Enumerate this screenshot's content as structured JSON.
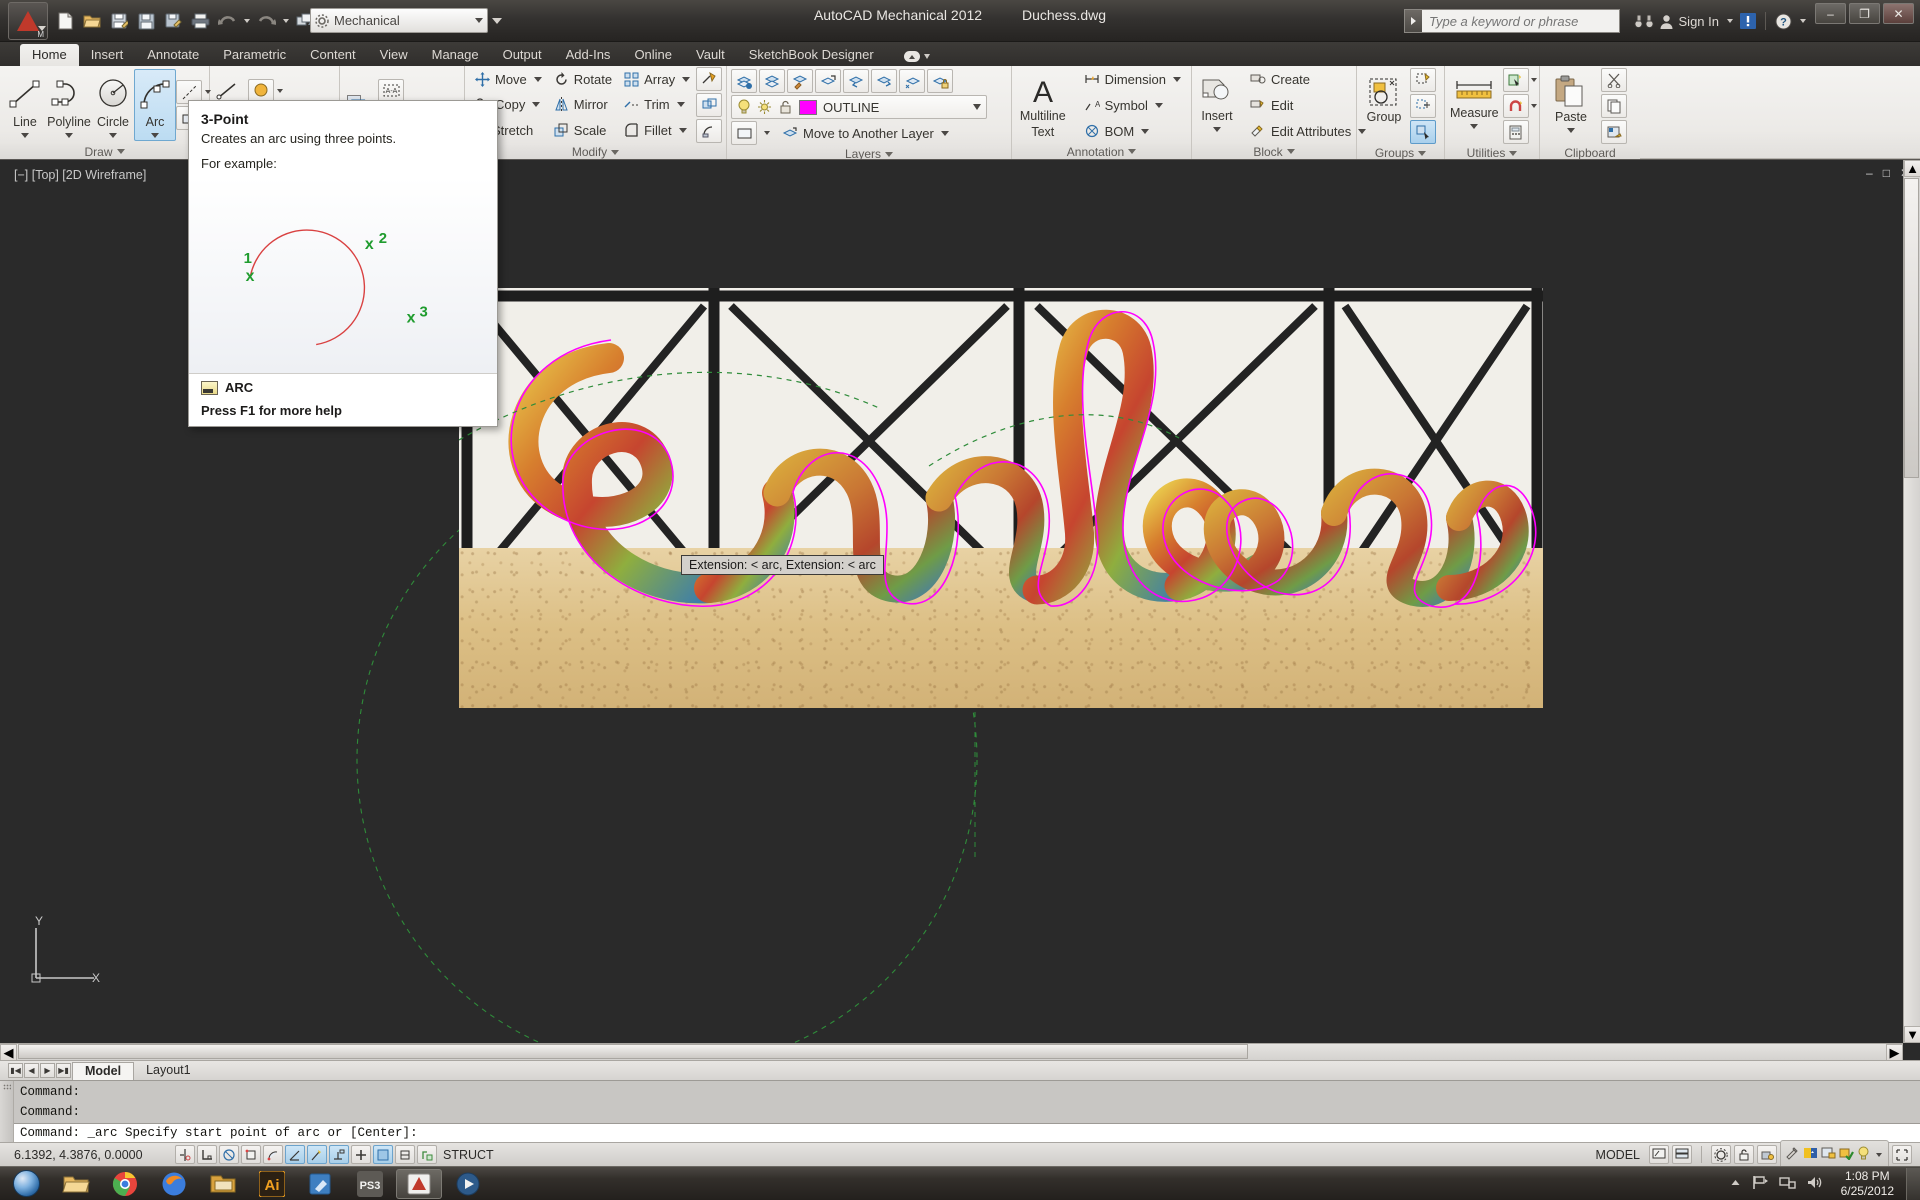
{
  "titlebar": {
    "app_title": "AutoCAD Mechanical 2012",
    "document_title": "Duchess.dwg",
    "workspace": "Mechanical",
    "search_placeholder": "Type a keyword or phrase",
    "signin_label": "Sign In",
    "quick_access": [
      {
        "name": "new-file-icon",
        "label": "New"
      },
      {
        "name": "open-file-icon",
        "label": "Open"
      },
      {
        "name": "save-as-icon",
        "label": "Save As"
      },
      {
        "name": "save-icon",
        "label": "Save"
      },
      {
        "name": "save-copy-icon",
        "label": "Save Copy"
      },
      {
        "name": "print-icon",
        "label": "Plot"
      },
      {
        "name": "undo-icon",
        "label": "Undo"
      },
      {
        "name": "redo-icon",
        "label": "Redo"
      },
      {
        "name": "batch-icon",
        "label": "Batch"
      }
    ],
    "window_controls": {
      "minimize": "–",
      "maximize": "❐",
      "close": "✕"
    }
  },
  "ribbon": {
    "tabs": [
      {
        "label": "Home",
        "active": true
      },
      {
        "label": "Insert",
        "active": false
      },
      {
        "label": "Annotate",
        "active": false
      },
      {
        "label": "Parametric",
        "active": false
      },
      {
        "label": "Content",
        "active": false
      },
      {
        "label": "View",
        "active": false
      },
      {
        "label": "Manage",
        "active": false
      },
      {
        "label": "Output",
        "active": false
      },
      {
        "label": "Add-Ins",
        "active": false
      },
      {
        "label": "Online",
        "active": false
      },
      {
        "label": "Vault",
        "active": false
      },
      {
        "label": "SketchBook Designer",
        "active": false
      }
    ],
    "panels": {
      "draw": {
        "title": "Draw",
        "buttons": [
          {
            "label": "Line",
            "icon": "line-icon",
            "selected": false
          },
          {
            "label": "Polyline",
            "icon": "polyline-icon",
            "selected": false
          },
          {
            "label": "Circle",
            "icon": "circle-icon",
            "selected": false
          },
          {
            "label": "Arc",
            "icon": "arc-icon",
            "selected": true
          }
        ],
        "small_icons": [
          {
            "name": "construction-line-icon"
          },
          {
            "name": "rectangle-icon"
          },
          {
            "name": "ray-icon"
          },
          {
            "name": "hatch-icon"
          },
          {
            "name": "region-icon"
          },
          {
            "name": "text-frame-icon"
          },
          {
            "name": "revision-cloud-icon"
          }
        ]
      },
      "modify": {
        "title": "Modify",
        "items": [
          {
            "label": "Move",
            "icon": "move-icon",
            "has_dropdown": true
          },
          {
            "label": "Rotate",
            "icon": "rotate-icon",
            "has_dropdown": false
          },
          {
            "label": "Array",
            "icon": "array-icon",
            "has_dropdown": true
          },
          {
            "label": "Copy",
            "icon": "copy-icon",
            "has_dropdown": true
          },
          {
            "label": "Mirror",
            "icon": "mirror-icon",
            "has_dropdown": false
          },
          {
            "label": "Trim",
            "icon": "trim-icon",
            "has_dropdown": true
          },
          {
            "label": "Stretch",
            "icon": "stretch-icon",
            "has_dropdown": false
          },
          {
            "label": "Scale",
            "icon": "scale-icon",
            "has_dropdown": false
          },
          {
            "label": "Fillet",
            "icon": "fillet-icon",
            "has_dropdown": true
          }
        ],
        "side_icons": [
          {
            "name": "break-icon"
          },
          {
            "name": "join-icon"
          },
          {
            "name": "chamfer-icon"
          },
          {
            "name": "explode-icon"
          }
        ]
      },
      "layers": {
        "title": "Layers",
        "current_layer": "OUTLINE",
        "layer_color": "#FF00FF",
        "move_to_layer_label": "Move to Another Layer",
        "top_icons": [
          {
            "name": "layer-properties-icon"
          },
          {
            "name": "layer-state-icon"
          },
          {
            "name": "layer-match-icon"
          },
          {
            "name": "layer-previous-icon"
          },
          {
            "name": "layer-off-icon"
          },
          {
            "name": "layer-isolate-icon"
          },
          {
            "name": "layer-freeze-icon"
          },
          {
            "name": "layer-lock-icon"
          }
        ]
      },
      "annotation": {
        "title": "Annotation",
        "big_button": {
          "label_line1": "Multiline",
          "label_line2": "Text",
          "icon": "multiline-text-icon"
        },
        "items": [
          {
            "label": "Dimension",
            "icon": "dimension-icon",
            "has_dropdown": true
          },
          {
            "label": "Symbol",
            "icon": "symbol-icon",
            "has_dropdown": true
          },
          {
            "label": "BOM",
            "icon": "bom-icon",
            "has_dropdown": true
          }
        ]
      },
      "block": {
        "title": "Block",
        "big_button": {
          "label": "Insert",
          "icon": "insert-block-icon"
        },
        "items": [
          {
            "label": "Create",
            "icon": "create-block-icon",
            "has_dropdown": false
          },
          {
            "label": "Edit",
            "icon": "edit-block-icon",
            "has_dropdown": false
          },
          {
            "label": "Edit Attributes",
            "icon": "edit-attributes-icon",
            "has_dropdown": true
          }
        ]
      },
      "groups": {
        "title": "Groups",
        "big_button": {
          "label": "Group",
          "icon": "group-icon"
        },
        "side_icons": [
          {
            "name": "ungroup-icon",
            "selected": false
          },
          {
            "name": "group-edit-icon",
            "selected": false
          },
          {
            "name": "group-selection-icon",
            "selected": true
          }
        ]
      },
      "utilities": {
        "title": "Utilities",
        "big_button": {
          "label": "Measure",
          "icon": "measure-icon"
        },
        "side_icons": [
          {
            "name": "quick-select-icon"
          },
          {
            "name": "point-snap-icon"
          },
          {
            "name": "calculator-icon"
          }
        ]
      },
      "clipboard": {
        "title": "Clipboard",
        "big_button": {
          "label": "Paste",
          "icon": "paste-icon"
        },
        "side_icons": [
          {
            "name": "cut-icon"
          },
          {
            "name": "copy-clipboard-icon"
          },
          {
            "name": "paste-special-icon"
          }
        ]
      }
    }
  },
  "tooltip": {
    "title": "3-Point",
    "description": "Creates an arc using three points.",
    "example_label": "For example:",
    "command_name": "ARC",
    "help_hint": "Press F1 for more help",
    "point_labels": [
      "1",
      "2",
      "3"
    ],
    "arc_color": "#d94141",
    "point_color": "#1f9c2e"
  },
  "drawing": {
    "viewport_label": "[−] [Top] [2D Wireframe]",
    "snap_tooltip": "Extension: < arc,  Extension: < arc",
    "ucs_axis_x": "X",
    "ucs_axis_y": "Y",
    "photo_alt": "Colorful painted cursive word sculpture on sand in front of lattice fence"
  },
  "layout_bar": {
    "tabs": [
      {
        "label": "Model",
        "active": true
      },
      {
        "label": "Layout1",
        "active": false
      }
    ],
    "nav_buttons": [
      "first",
      "prev",
      "next",
      "last"
    ]
  },
  "command_line": {
    "history": [
      "Command:",
      "Command:"
    ],
    "current": "Command: _arc Specify start point of arc or [Center]:"
  },
  "status_bar": {
    "coordinates": "6.1392, 4.3876, 0.0000",
    "struct_label": "STRUCT",
    "model_label": "MODEL",
    "toggles": [
      {
        "name": "infer-constraints-toggle",
        "on": false
      },
      {
        "name": "snap-mode-toggle",
        "on": false
      },
      {
        "name": "grid-display-toggle",
        "on": false
      },
      {
        "name": "ortho-mode-toggle",
        "on": false
      },
      {
        "name": "polar-tracking-toggle",
        "on": false
      },
      {
        "name": "object-snap-toggle",
        "on": true
      },
      {
        "name": "object-snap-tracking-toggle",
        "on": true
      },
      {
        "name": "dynamic-ucs-toggle",
        "on": true
      },
      {
        "name": "dynamic-input-toggle",
        "on": false
      },
      {
        "name": "lineweight-toggle",
        "on": true
      },
      {
        "name": "transparency-toggle",
        "on": false
      },
      {
        "name": "quick-properties-toggle",
        "on": false
      }
    ],
    "right_icons": [
      {
        "name": "model-space-icon"
      },
      {
        "name": "layout-space-icon"
      },
      {
        "name": "annotation-scale-icon"
      },
      {
        "name": "annotation-visibility-icon"
      },
      {
        "name": "annotation-autoscale-icon"
      },
      {
        "name": "workspace-switch-icon"
      },
      {
        "name": "toolbar-lock-icon"
      },
      {
        "name": "hardware-accel-icon"
      },
      {
        "name": "isolate-objects-icon"
      },
      {
        "name": "clean-screen-icon"
      }
    ]
  },
  "taskbar": {
    "start_label": "Start",
    "items": [
      {
        "name": "taskbar-explorer",
        "label": "Windows Explorer",
        "active": false
      },
      {
        "name": "taskbar-chrome",
        "label": "Google Chrome",
        "active": false
      },
      {
        "name": "taskbar-firefox",
        "label": "Firefox",
        "active": false
      },
      {
        "name": "taskbar-folder",
        "label": "Folder",
        "active": false
      },
      {
        "name": "taskbar-illustrator",
        "label": "Ai",
        "active": false
      },
      {
        "name": "taskbar-sketchbook",
        "label": "SketchBook",
        "active": false
      },
      {
        "name": "taskbar-ps",
        "label": "PS3",
        "active": false
      },
      {
        "name": "taskbar-autocad",
        "label": "AutoCAD Mechanical",
        "active": true
      },
      {
        "name": "taskbar-media",
        "label": "Media",
        "active": false
      }
    ],
    "tray": {
      "time": "1:08 PM",
      "date": "6/25/2012",
      "icons": [
        {
          "name": "show-hidden-icons"
        },
        {
          "name": "action-center-flag-icon"
        },
        {
          "name": "network-icon"
        },
        {
          "name": "volume-icon"
        }
      ]
    }
  }
}
